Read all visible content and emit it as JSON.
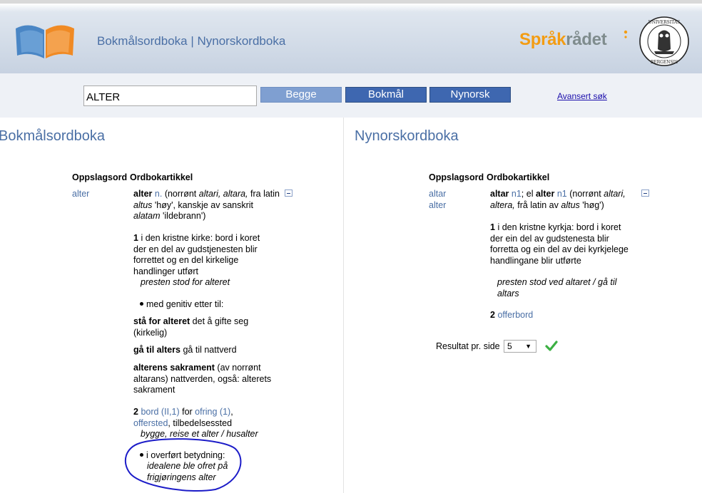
{
  "header": {
    "title_left": "Bokmålsordboka",
    "title_sep": " | ",
    "title_right": "Nynorskordboka",
    "sprak_logo_part1": "Språk",
    "sprak_logo_part2": "rådet",
    "uib_seal_text_top": "UNIVERSITAS",
    "uib_seal_text_bottom": "BERGENSIS"
  },
  "search": {
    "value": "ALTER",
    "buttons": [
      "Begge",
      "Bokmål",
      "Nynorsk"
    ],
    "advanced_link": "Avansert søk"
  },
  "bokmal": {
    "title": "Bokmålsordboka",
    "col_headword": "Oppslagsord",
    "col_article": "Ordbokartikkel",
    "headword": "alter",
    "article": {
      "intro_word": "alter",
      "intro_pos": "n.",
      "intro_rest_1": "(norrønt ",
      "intro_alt1": "altari, altara,",
      "intro_rest_2": " fra latin ",
      "intro_alt2": "altus",
      "intro_rest_3": " 'høy', kanskje av sanskrit ",
      "intro_alt3": "alatam",
      "intro_rest_4": " 'ildebrann')",
      "sense1_num": "1",
      "sense1_text": "i den kristne kirke: bord i koret der en del av gudstjenesten blir forrettet og en del kirkelige handlinger utført",
      "sense1_example": "presten stod for alteret",
      "bullet1": "med genitiv etter til:",
      "phrase1_bold": "stå for alteret",
      "phrase1_rest": " det å gifte seg (kirkelig)",
      "phrase2_bold": "gå til alters",
      "phrase2_rest": " gå til nattverd",
      "phrase3_bold": "alterens sakrament",
      "phrase3_rest": " (av norrønt altarans) nattverden, også: alterets sakrament",
      "sense2_num": "2",
      "sense2_link1": "bord (II,1)",
      "sense2_for": " for ",
      "sense2_link2": "ofring (1)",
      "sense2_comma": ",",
      "sense2_link3": "offersted",
      "sense2_rest": ", tilbedelsessted",
      "sense2_example": "bygge, reise et alter / husalter",
      "bullet2": "i overført betydning:",
      "bullet2_example": "idealene ble ofret på frigjøringens alter"
    }
  },
  "nynorsk": {
    "title": "Nynorskordboka",
    "col_headword": "Oppslagsord",
    "col_article": "Ordbokartikkel",
    "headwords": [
      "altar",
      "alter"
    ],
    "article": {
      "w1": "altar",
      "g1": "n1",
      "sep": "; el ",
      "w2": "alter",
      "g2": "n1",
      "rest1": " (norrønt ",
      "alt1": "altari, altera,",
      "rest2": " frå latin av ",
      "alt2": "altus",
      "rest3": " 'høg')",
      "sense1_num": "1",
      "sense1_text": "i den kristne kyrkja: bord i koret der ein del av gudstenesta blir forretta og ein del av dei kyrkjelege handlingane blir utførte",
      "sense1_example": "presten stod ved altaret / gå til altars",
      "sense2_num": "2",
      "sense2_link": "offerbord"
    },
    "results_label": "Resultat pr. side",
    "results_value": "5"
  },
  "colors": {
    "accent_blue": "#4a6fa5",
    "button_blue": "#3e67b0",
    "button_light": "#7f9fd1",
    "sprak_orange": "#f39c12",
    "annotation_ink": "#1c1cc8"
  }
}
